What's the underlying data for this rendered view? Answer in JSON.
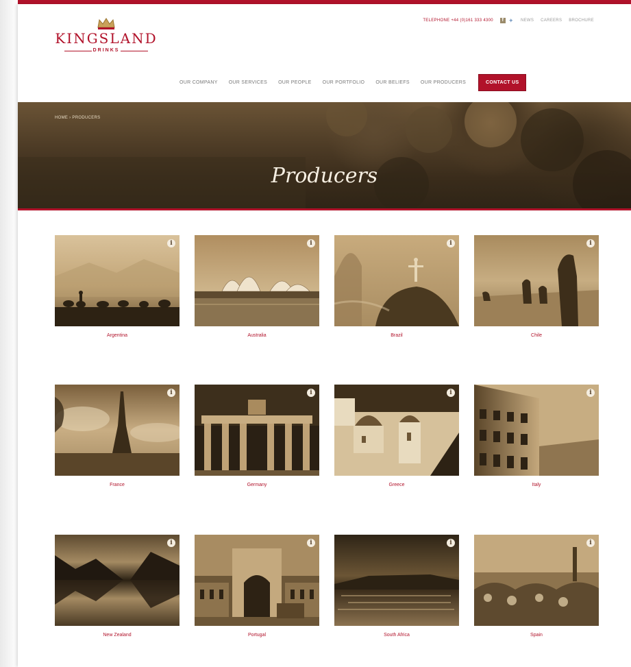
{
  "header": {
    "logo_name": "KINGSLAND",
    "logo_sub": "DRINKS",
    "telephone": "TELEPHONE +44 (0)161 333 4300",
    "links": [
      "NEWS",
      "CAREERS",
      "BROCHURE"
    ]
  },
  "nav": {
    "items": [
      "OUR COMPANY",
      "OUR SERVICES",
      "OUR PEOPLE",
      "OUR PORTFOLIO",
      "OUR BELIEFS",
      "OUR PRODUCERS"
    ],
    "contact": "CONTACT US"
  },
  "hero": {
    "breadcrumb": "HOME › PRODUCERS",
    "title": "Producers"
  },
  "producers": [
    {
      "label": "Argentina",
      "scene": "desert-riders"
    },
    {
      "label": "Australia",
      "scene": "opera-house"
    },
    {
      "label": "Brazil",
      "scene": "christ-statue"
    },
    {
      "label": "Chile",
      "scene": "moai"
    },
    {
      "label": "France",
      "scene": "eiffel-tower"
    },
    {
      "label": "Germany",
      "scene": "brandenburg-gate"
    },
    {
      "label": "Greece",
      "scene": "santorini"
    },
    {
      "label": "Italy",
      "scene": "colosseum"
    },
    {
      "label": "New Zealand",
      "scene": "lake-mountains"
    },
    {
      "label": "Portugal",
      "scene": "arch-square"
    },
    {
      "label": "South Africa",
      "scene": "table-mountain"
    },
    {
      "label": "Spain",
      "scene": "park-guell"
    }
  ],
  "colors": {
    "accent": "#b1122a",
    "sepia_light": "#c9a97a",
    "sepia_dark": "#3b2a17"
  },
  "icons": [
    "crown-icon",
    "facebook-icon",
    "twitter-icon",
    "info-icon"
  ]
}
